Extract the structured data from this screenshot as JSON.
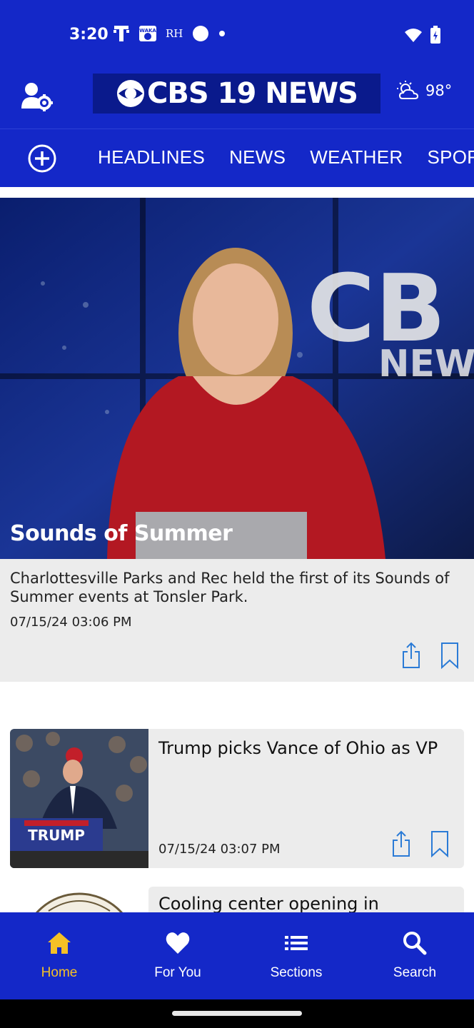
{
  "status": {
    "time": "3:20",
    "left_icons": [
      "t-mobile-icon",
      "waka-icon",
      "rh-icon",
      "circle-icon",
      "dot-icon"
    ],
    "rh_text": "RH",
    "right_icons": [
      "wifi-icon",
      "battery-charging-icon"
    ]
  },
  "header": {
    "logo_text": "CBS 19 NEWS",
    "weather_temp": "98°",
    "weather_icon": "partly-sunny-icon"
  },
  "nav": {
    "tabs": [
      "HEADLINES",
      "NEWS",
      "WEATHER",
      "SPORTS"
    ]
  },
  "hero": {
    "title": "Sounds of Summer",
    "description": "Charlottesville Parks and Rec held the first of its Sounds of Summer events at Tonsler Park.",
    "date": "07/15/24 03:06 PM"
  },
  "stories": [
    {
      "title": "Trump picks Vance of Ohio as VP",
      "date": "07/15/24 03:07 PM"
    },
    {
      "title": "Cooling center opening in"
    }
  ],
  "bottom_nav": {
    "items": [
      {
        "label": "Home",
        "icon": "home-icon",
        "active": true
      },
      {
        "label": "For You",
        "icon": "heart-icon",
        "active": false
      },
      {
        "label": "Sections",
        "icon": "list-icon",
        "active": false
      },
      {
        "label": "Search",
        "icon": "search-icon",
        "active": false
      }
    ]
  },
  "colors": {
    "brand_blue": "#1428c8",
    "active_yellow": "#f5c026",
    "card_gray": "#ececec"
  }
}
